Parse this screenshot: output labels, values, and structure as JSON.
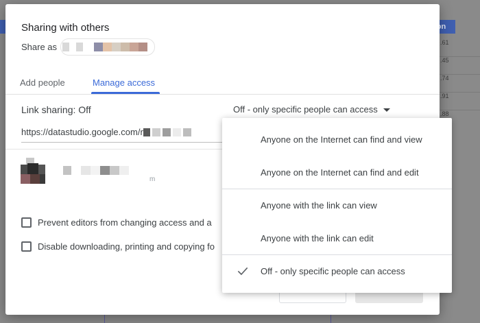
{
  "dialog": {
    "title": "Sharing with others",
    "share_as_label": "Share as"
  },
  "tabs": [
    {
      "label": "Add people"
    },
    {
      "label": "Manage access"
    }
  ],
  "link_sharing": {
    "label": "Link sharing: Off",
    "selected": "Off - only specific people can access",
    "url": "https://datastudio.google.com/r"
  },
  "person": {
    "email_tail": "m"
  },
  "options": [
    {
      "label": "Prevent editors from changing access and a"
    },
    {
      "label": "Disable downloading, printing and copying fo"
    }
  ],
  "dropdown": {
    "items": [
      {
        "label": "Anyone on the Internet can find and view"
      },
      {
        "label": "Anyone on the Internet can find and edit"
      },
      {
        "label": "Anyone with the link can view"
      },
      {
        "label": "Anyone with the link can edit"
      },
      {
        "label": "Off - only specific people can access",
        "checked": true
      }
    ]
  },
  "background": {
    "column_header": "ion",
    "values": [
      ".61",
      ".45",
      ".74",
      ".91",
      ".88"
    ]
  },
  "colors": {
    "accent": "#3b6ad8",
    "text": "#3c4043"
  },
  "icons": {
    "dropdown_caret": "caret-down-icon",
    "check": "check-icon"
  }
}
